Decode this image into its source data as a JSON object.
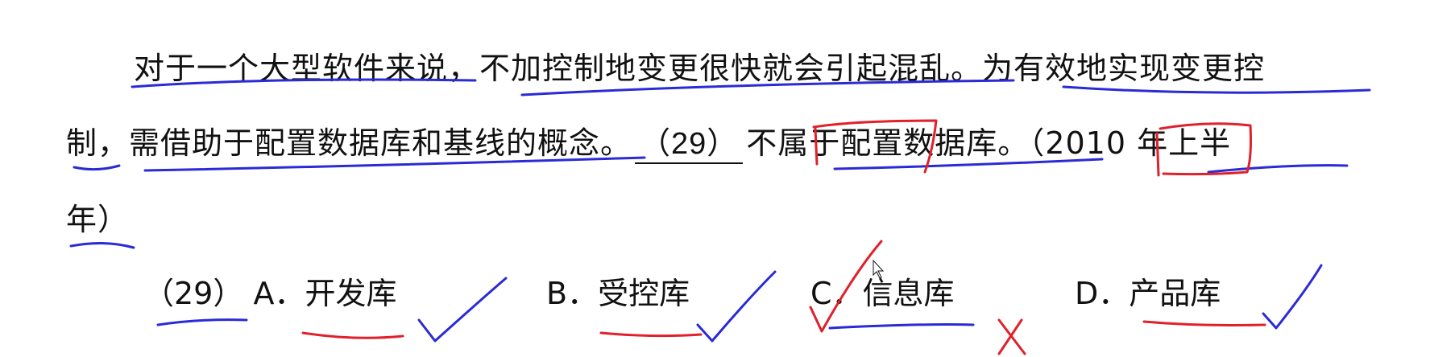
{
  "question": {
    "line1": "对于一个大型软件来说，不加控制地变更很快就会引起混乱。为有效地实现变更控",
    "line2_pre": "制，需借助于配置数据库和基线的概念。",
    "blank": "（29）",
    "line2_post": "不属于配置数据库。（2010 年上半",
    "line3": "年）"
  },
  "options": {
    "label": "（29）",
    "A": "A．开发库",
    "B": "B．受控库",
    "C": "C．信息库",
    "D": "D．产品库"
  },
  "annotation_colors": {
    "blue": "#2a2ad6",
    "red": "#e0202a"
  }
}
